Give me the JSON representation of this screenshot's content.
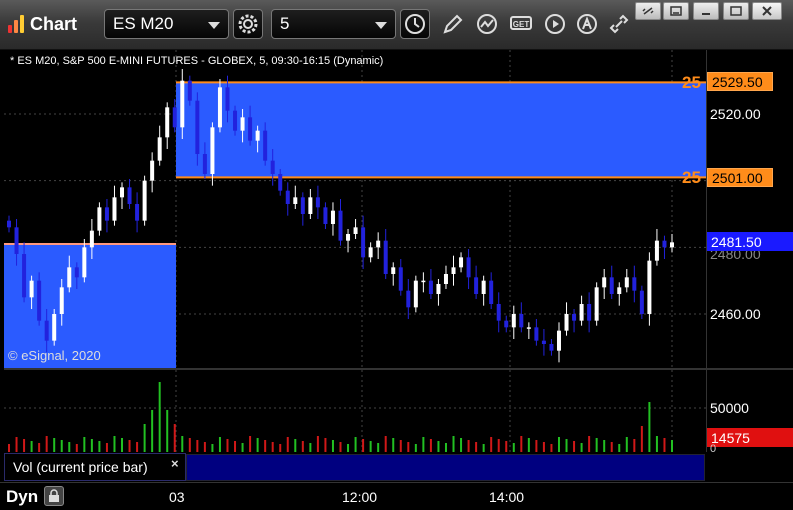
{
  "toolbar": {
    "app_title": "Chart",
    "symbol_value": "ES M20",
    "interval_value": "5",
    "icons": [
      "settings-icon",
      "clock-icon",
      "pencil-icon",
      "study-icon",
      "get-icon",
      "play-icon",
      "alert-icon",
      "link-icon"
    ],
    "window_buttons": [
      "minimize-icon",
      "restore-icon",
      "maximize-icon",
      "close-icon"
    ]
  },
  "chart": {
    "description": "* ES M20, S&P 500 E-MINI FUTURES - GLOBEX, 5, 09:30-16:15 (Dynamic)",
    "copyright": "© eSignal, 2020",
    "price_ticks": [
      "2520.00",
      "2460.00"
    ],
    "partial_tick": "2480.00",
    "last_price": "2481.50",
    "levels": [
      {
        "price": "2529.50",
        "tag": "25"
      },
      {
        "price": "2501.00",
        "tag": "25"
      }
    ],
    "colors": {
      "zone": "#2b5bff",
      "level_line": "#ff8c1a",
      "bull": "#ffffff",
      "bear": "#2222dd",
      "last_price_badge": "#1a1aff",
      "level_badge": "#ff8c1a"
    }
  },
  "volume": {
    "label": "Vol (current price bar)",
    "close_glyph": "×",
    "tick": "50000",
    "zero_tick": "0",
    "current": "14575",
    "badge_color": "#e01010"
  },
  "time_axis": {
    "ticks": [
      "03",
      "12:00",
      "14:00"
    ],
    "mode_label": "Dyn"
  },
  "chart_data": {
    "type": "candlestick",
    "title": "* ES M20, S&P 500 E-MINI FUTURES - GLOBEX, 5, 09:30-16:15 (Dynamic)",
    "y_range": [
      2445,
      2540
    ],
    "horizontal_levels": [
      2529.5,
      2501.0
    ],
    "last": 2481.5,
    "x_ticks": [
      "03",
      "12:00",
      "14:00"
    ],
    "series": [
      {
        "name": "close",
        "values": [
          2486,
          2478,
          2465,
          2470,
          2458,
          2452,
          2460,
          2468,
          2474,
          2471,
          2480,
          2485,
          2492,
          2488,
          2495,
          2498,
          2493,
          2488,
          2500,
          2506,
          2513,
          2522,
          2516,
          2530,
          2524,
          2508,
          2502,
          2516,
          2528,
          2521,
          2515,
          2519,
          2512,
          2515,
          2506,
          2502,
          2497,
          2493,
          2495,
          2490,
          2495,
          2492,
          2487,
          2491,
          2482,
          2484,
          2486,
          2477,
          2480,
          2482,
          2472,
          2474,
          2467,
          2462,
          2470,
          2470,
          2466,
          2469,
          2472,
          2474,
          2477,
          2471,
          2466,
          2470,
          2463,
          2458,
          2456,
          2460,
          2456,
          2456,
          2452,
          2451,
          2449,
          2455,
          2460,
          2458,
          2463,
          2458,
          2468,
          2471,
          2466,
          2468,
          2471,
          2467,
          2460,
          2476,
          2482,
          2480,
          2481.5
        ]
      }
    ]
  }
}
